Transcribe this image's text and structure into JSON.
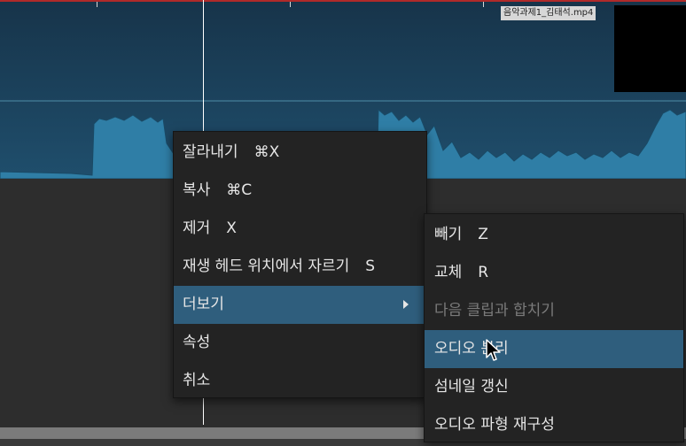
{
  "clip": {
    "filename": "음악과제1_김태석.mp4"
  },
  "context_menu": {
    "items": [
      {
        "label": "잘라내기",
        "shortcut": "⌘X"
      },
      {
        "label": "복사",
        "shortcut": "⌘C"
      },
      {
        "label": "제거",
        "shortcut": "X"
      },
      {
        "label": "재생 헤드 위치에서 자르기",
        "shortcut": "S"
      },
      {
        "label": "더보기",
        "shortcut": ""
      },
      {
        "label": "속성",
        "shortcut": ""
      },
      {
        "label": "취소",
        "shortcut": ""
      }
    ]
  },
  "submenu": {
    "items": [
      {
        "label": "빼기",
        "shortcut": "Z"
      },
      {
        "label": "교체",
        "shortcut": "R"
      },
      {
        "label": "다음 클립과 합치기",
        "shortcut": ""
      },
      {
        "label": "오디오 분리",
        "shortcut": ""
      },
      {
        "label": "섬네일 갱신",
        "shortcut": ""
      },
      {
        "label": "오디오 파형 재구성",
        "shortcut": ""
      }
    ]
  },
  "colors": {
    "accent": "#2f5e7d",
    "clip_border": "#c43030",
    "waveform": "#2f7ea6"
  }
}
